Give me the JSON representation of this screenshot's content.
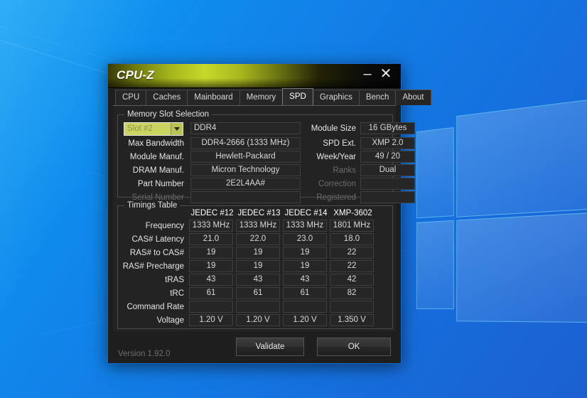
{
  "window": {
    "title": "CPU-Z",
    "minimize_label": "–",
    "close_label": "✕",
    "version": "Version 1.92.0"
  },
  "tabs": [
    {
      "label": "CPU",
      "active": false
    },
    {
      "label": "Caches",
      "active": false
    },
    {
      "label": "Mainboard",
      "active": false
    },
    {
      "label": "Memory",
      "active": false
    },
    {
      "label": "SPD",
      "active": true
    },
    {
      "label": "Graphics",
      "active": false
    },
    {
      "label": "Bench",
      "active": false
    },
    {
      "label": "About",
      "active": false
    }
  ],
  "memory_slot_selection": {
    "legend": "Memory Slot Selection",
    "slot_combo": {
      "value": "Slot #2",
      "arrow": "chevron-down"
    },
    "module_type": "DDR4",
    "left_rows": [
      {
        "label": "Max Bandwidth",
        "value": "DDR4-2666 (1333 MHz)",
        "dim": false
      },
      {
        "label": "Module Manuf.",
        "value": "Hewlett-Packard",
        "dim": false
      },
      {
        "label": "DRAM Manuf.",
        "value": "Micron Technology",
        "dim": false
      },
      {
        "label": "Part Number",
        "value": "2E2L4AA#",
        "dim": false
      },
      {
        "label": "Serial Number",
        "value": "",
        "dim": true
      }
    ],
    "right_rows": [
      {
        "label": "Module Size",
        "value": "16 GBytes",
        "dim": false
      },
      {
        "label": "SPD Ext.",
        "value": "XMP 2.0",
        "dim": false
      },
      {
        "label": "Week/Year",
        "value": "49 / 20",
        "dim": false
      },
      {
        "label": "Ranks",
        "value": "Dual",
        "dim": true
      },
      {
        "label": "Correction",
        "value": "",
        "dim": true
      },
      {
        "label": "Registered",
        "value": "",
        "dim": true
      }
    ]
  },
  "timings_table": {
    "legend": "Timings Table",
    "columns": [
      "JEDEC #12",
      "JEDEC #13",
      "JEDEC #14",
      "XMP-3602"
    ],
    "rows": [
      {
        "label": "Frequency",
        "values": [
          "1333 MHz",
          "1333 MHz",
          "1333 MHz",
          "1801 MHz"
        ]
      },
      {
        "label": "CAS# Latency",
        "values": [
          "21.0",
          "22.0",
          "23.0",
          "18.0"
        ]
      },
      {
        "label": "RAS# to CAS#",
        "values": [
          "19",
          "19",
          "19",
          "22"
        ]
      },
      {
        "label": "RAS# Precharge",
        "values": [
          "19",
          "19",
          "19",
          "22"
        ]
      },
      {
        "label": "tRAS",
        "values": [
          "43",
          "43",
          "43",
          "42"
        ]
      },
      {
        "label": "tRC",
        "values": [
          "61",
          "61",
          "61",
          "82"
        ]
      },
      {
        "label": "Command Rate",
        "values": [
          "",
          "",
          "",
          ""
        ]
      },
      {
        "label": "Voltage",
        "values": [
          "1.20 V",
          "1.20 V",
          "1.20 V",
          "1.350 V"
        ]
      }
    ]
  },
  "buttons": {
    "validate": "Validate",
    "ok": "OK"
  },
  "colors": {
    "titlebar_accent": "#c7d82a",
    "combo_background": "#cbd461",
    "window_border": "#1866c8",
    "desktop_blue": "#1184ea"
  }
}
